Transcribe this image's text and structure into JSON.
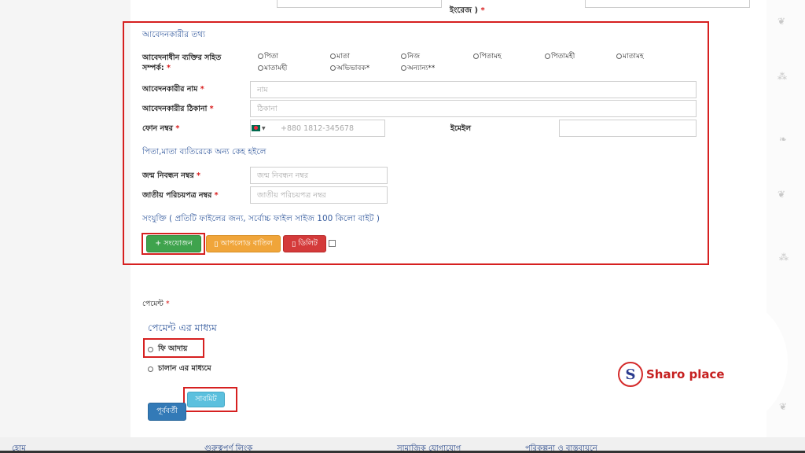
{
  "top": {
    "label_fragment": "ইংরেজ )",
    "required_mark": "*"
  },
  "applicant": {
    "section_title": "আবেদনকারীর তথ্য",
    "relation": {
      "label": "আবেদনাধীন ব্যক্তির সহিত সম্পর্ক:",
      "required_mark": "*",
      "options": [
        "পিতা",
        "মাতা",
        "নিজ",
        "পিতামহ",
        "পিতামহী",
        "মাতামহ",
        "মাতামহী",
        "অভিভাবক*",
        "অন্যান্য**"
      ]
    },
    "name": {
      "label": "আবেদনকারীর নাম",
      "required_mark": "*",
      "placeholder": "নাম"
    },
    "address": {
      "label": "আবেদনকারীর ঠিকানা",
      "required_mark": "*",
      "placeholder": "ঠিকানা"
    },
    "phone": {
      "label": "ফোন নম্বর",
      "required_mark": "*",
      "placeholder": "+880 1812-345678"
    },
    "email": {
      "label": "ইমেইল",
      "placeholder": ""
    },
    "other_guardian_title": "পিতা,মাতা ব্যতিরেকে অন্য কেহ হইলে",
    "birth_reg": {
      "label": "জন্ম নিবন্ধন নম্বর",
      "required_mark": "*",
      "placeholder": "জন্ম নিবন্ধন নম্বর"
    },
    "nid": {
      "label": "জাতীয় পরিচয়পত্র নম্বর",
      "required_mark": "*",
      "placeholder": "জাতীয় পরিচয়পত্র নম্বর"
    },
    "attachment_title": "সংযুক্তি ( প্রতিটি ফাইলের জন্য, সর্বোচ্চ ফাইল সাইজ 100 কিলো বাইট )",
    "buttons": {
      "add": "+ সংযোজন",
      "cancel_upload": "আপলোড বাতিল",
      "delete": "ডিলিট"
    }
  },
  "payment": {
    "label": "পেমেন্ট",
    "required_mark": "*",
    "method_title": "পেমেন্ট এর মাধ্যম",
    "options": [
      "ফি আদায়",
      "চালান এর মাধ্যমে"
    ],
    "submit": "সাবমিট",
    "previous": "পূর্ববর্তী"
  },
  "logo": {
    "mark": "S",
    "text": "Sharo place"
  },
  "footer": {
    "links": [
      "হোম",
      "গুরুত্বপূর্ণ লিংক",
      "সামাজিক যোগাযোগ",
      "পরিকল্পনা ও বাস্তবায়নে"
    ]
  }
}
